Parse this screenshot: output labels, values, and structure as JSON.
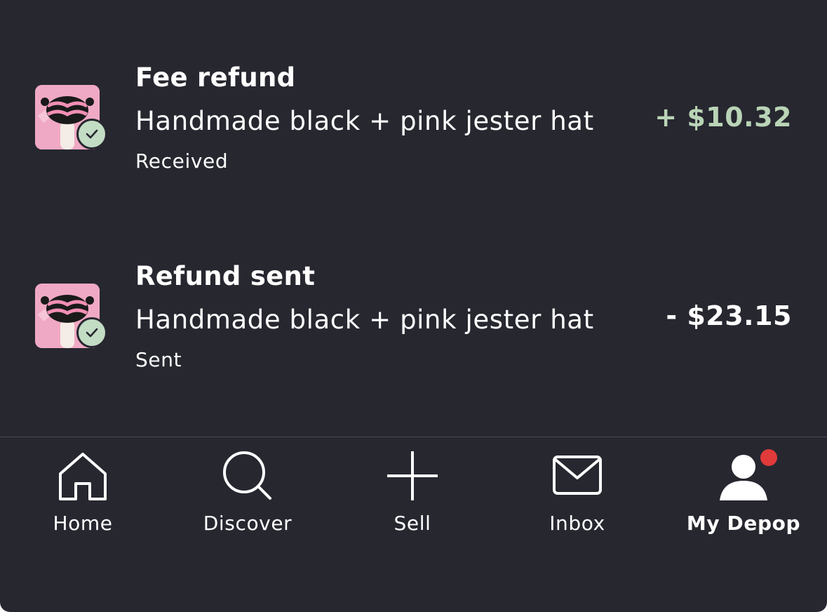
{
  "transactions": [
    {
      "title": "Fee refund",
      "description": "Handmade black + pink jester hat",
      "status": "Received",
      "amount": "+ $10.32",
      "direction": "positive",
      "thumbnail_icon": "jester-hat-thumbnail",
      "badge_icon": "check-icon"
    },
    {
      "title": "Refund sent",
      "description": "Handmade black + pink jester hat",
      "status": "Sent",
      "amount": "- $23.15",
      "direction": "negative",
      "thumbnail_icon": "jester-hat-thumbnail",
      "badge_icon": "check-icon"
    }
  ],
  "tabbar": {
    "items": [
      {
        "label": "Home",
        "icon": "home-icon",
        "active": false
      },
      {
        "label": "Discover",
        "icon": "search-icon",
        "active": false
      },
      {
        "label": "Sell",
        "icon": "plus-icon",
        "active": false
      },
      {
        "label": "Inbox",
        "icon": "mail-icon",
        "active": false
      },
      {
        "label": "My Depop",
        "icon": "profile-icon",
        "active": true,
        "notification_dot": true
      }
    ]
  },
  "colors": {
    "background": "#272730",
    "positive_amount": "#b9d4b6",
    "check_badge": "#c3dcc4",
    "notification_dot": "#e03a3a",
    "thumbnail_pink": "#f0a9c4"
  }
}
